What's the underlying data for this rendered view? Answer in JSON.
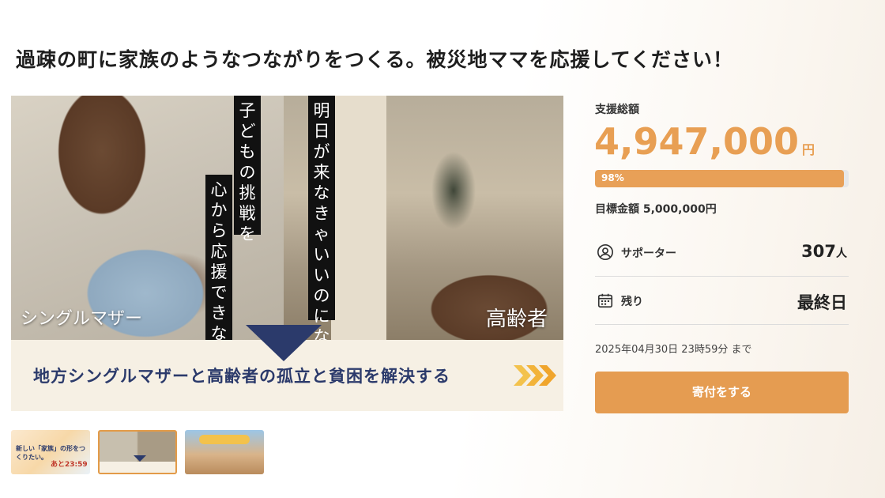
{
  "page": {
    "title": "過疎の町に家族のようなつながりをつくる。被災地ママを応援してください！"
  },
  "hero": {
    "vertical_text_1": "子どもの挑戦を",
    "vertical_text_2": "心から応援できない",
    "vertical_text_3": "明日が来なきゃいいのにな",
    "label_left": "シングルマザー",
    "label_right": "高齢者",
    "banner_text": "地方シングルマザーと高齢者の孤立と貧困を解決する"
  },
  "thumbnails": {
    "t1_text": "新しい「家族」の形をつくりたい。",
    "t1_timer": "あと23:59"
  },
  "funding": {
    "raised_label": "支援総額",
    "raised_amount": "4,947,000",
    "currency": "円",
    "progress_percent": 98,
    "progress_text": "98%",
    "goal_text": "目標金額 5,000,000円",
    "supporters_label": "サポーター",
    "supporters_count": "307",
    "supporters_unit": "人",
    "remaining_label": "残り",
    "remaining_value": "最終日",
    "deadline": "2025年04月30日 23時59分 まで",
    "cta_label": "寄付をする"
  },
  "colors": {
    "accent": "#e89f53",
    "navy": "#2b3a6b"
  },
  "icons": {
    "supporter": "user-circle-icon",
    "remaining": "calendar-icon",
    "banner": "triple-chevron-icon"
  }
}
